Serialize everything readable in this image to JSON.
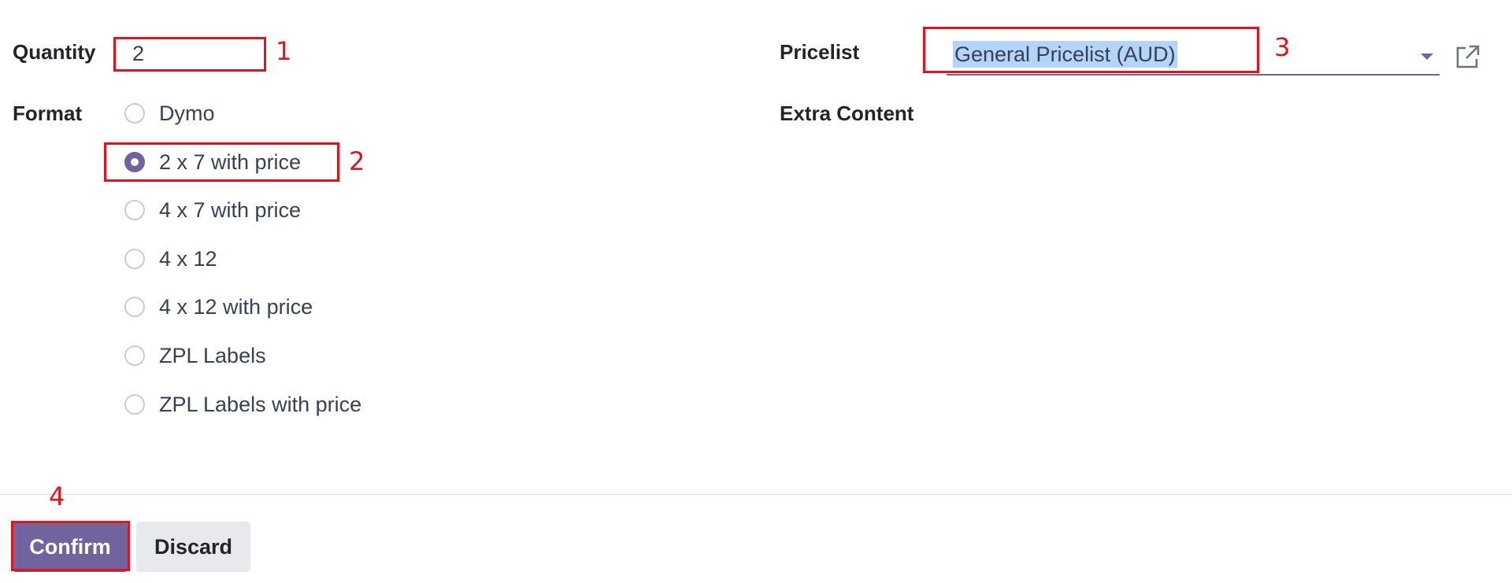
{
  "form": {
    "quantity": {
      "label": "Quantity",
      "value": "2"
    },
    "format": {
      "label": "Format",
      "options": [
        {
          "label": "Dymo",
          "selected": false
        },
        {
          "label": "2 x 7 with price",
          "selected": true
        },
        {
          "label": "4 x 7 with price",
          "selected": false
        },
        {
          "label": "4 x 12",
          "selected": false
        },
        {
          "label": "4 x 12 with price",
          "selected": false
        },
        {
          "label": "ZPL Labels",
          "selected": false
        },
        {
          "label": "ZPL Labels with price",
          "selected": false
        }
      ]
    },
    "pricelist": {
      "label": "Pricelist",
      "value": "General Pricelist (AUD)",
      "icons": [
        "caret-down-icon",
        "external-link-icon"
      ]
    },
    "extra_content": {
      "label": "Extra Content"
    }
  },
  "footer": {
    "confirm_label": "Confirm",
    "discard_label": "Discard"
  },
  "annotations": {
    "markers": [
      "1",
      "2",
      "3",
      "4"
    ],
    "color": "#e0141b"
  },
  "colors": {
    "primary": "#71639e",
    "secondary_button": "#e7e9ed",
    "selection_highlight": "#b3d4fc"
  }
}
